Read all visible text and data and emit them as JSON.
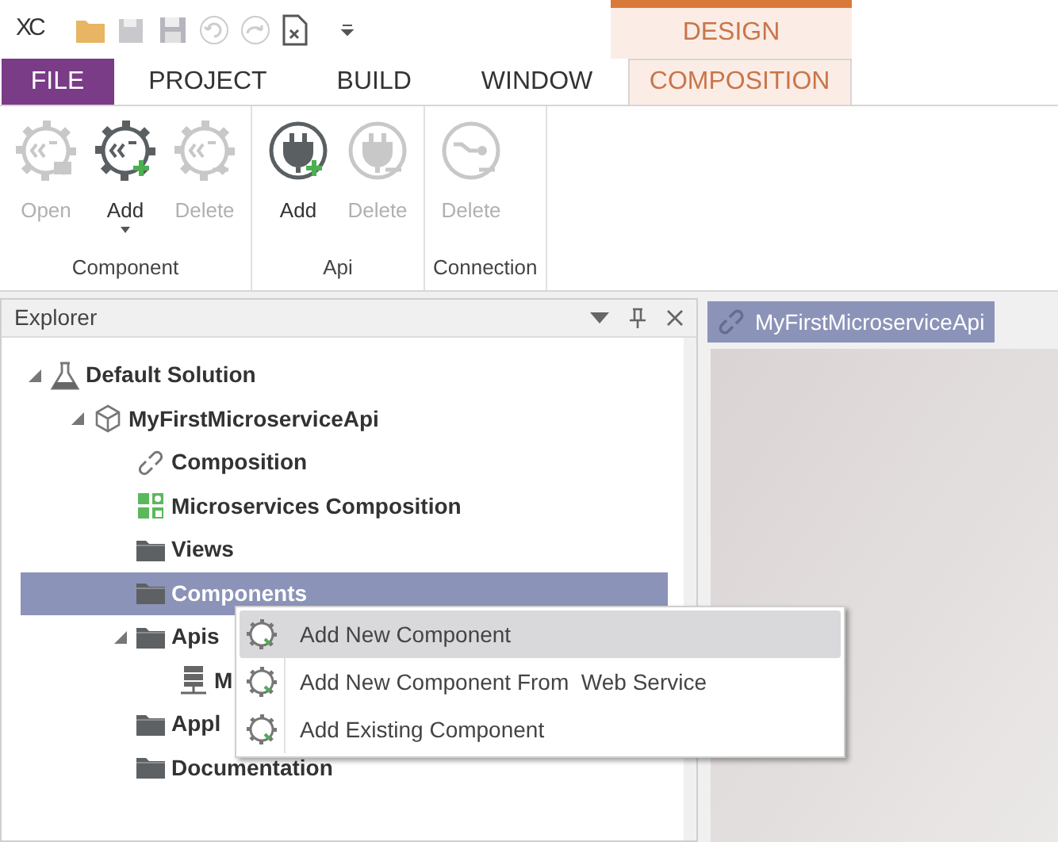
{
  "app": {
    "logo": "XC"
  },
  "tabs": [
    {
      "label": "FILE",
      "kind": "file",
      "selected": false
    },
    {
      "label": "PROJECT",
      "kind": "plain",
      "selected": false
    },
    {
      "label": "BUILD",
      "kind": "plain",
      "selected": false
    },
    {
      "label": "WINDOW",
      "kind": "plain",
      "selected": false
    },
    {
      "label": "COMPOSITION",
      "kind": "contextual",
      "context": "DESIGN",
      "selected": true
    }
  ],
  "ribbon": [
    {
      "label": "Component",
      "buttons": [
        {
          "label": "Open",
          "kind": "gear-open",
          "disabled": true,
          "dropdown": false
        },
        {
          "label": "Add",
          "kind": "gear-add",
          "disabled": false,
          "dropdown": true
        },
        {
          "label": "Delete",
          "kind": "gear-remove",
          "disabled": true,
          "dropdown": false
        }
      ]
    },
    {
      "label": "Api",
      "buttons": [
        {
          "label": "Add",
          "kind": "plug-add",
          "disabled": false,
          "dropdown": false
        },
        {
          "label": "Delete",
          "kind": "plug-remove",
          "disabled": true,
          "dropdown": false
        }
      ]
    },
    {
      "label": "Connection",
      "buttons": [
        {
          "label": "Delete",
          "kind": "link-remove",
          "disabled": true,
          "dropdown": false
        }
      ]
    }
  ],
  "explorer": {
    "title": "Explorer",
    "tree": [
      {
        "label": "Default Solution",
        "kind": "flask",
        "expanded": true,
        "selected": false,
        "children": [
          {
            "label": "MyFirstMicroserviceApi",
            "kind": "cube",
            "expanded": true,
            "selected": false,
            "children": [
              {
                "label": "Composition",
                "kind": "link",
                "selected": false
              },
              {
                "label": "Microservices Composition",
                "kind": "grid",
                "selected": false
              },
              {
                "label": "Views",
                "kind": "folder",
                "selected": false
              },
              {
                "label": "Components",
                "kind": "folder",
                "selected": true
              },
              {
                "label": "Apis",
                "kind": "folder",
                "expanded": true,
                "selected": false,
                "children": [
                  {
                    "label": "M",
                    "kind": "server",
                    "selected": false
                  }
                ]
              },
              {
                "label": "Appl",
                "kind": "folder",
                "selected": false
              },
              {
                "label": "Documentation",
                "kind": "folder",
                "selected": false
              }
            ]
          }
        ]
      }
    ]
  },
  "context_menu": [
    {
      "label": "Add New Component",
      "selected": true
    },
    {
      "label": "Add New Component From  Web Service",
      "selected": false
    },
    {
      "label": "Add Existing Component",
      "selected": false
    }
  ],
  "document_tab": {
    "label": "MyFirstMicroserviceApi"
  }
}
